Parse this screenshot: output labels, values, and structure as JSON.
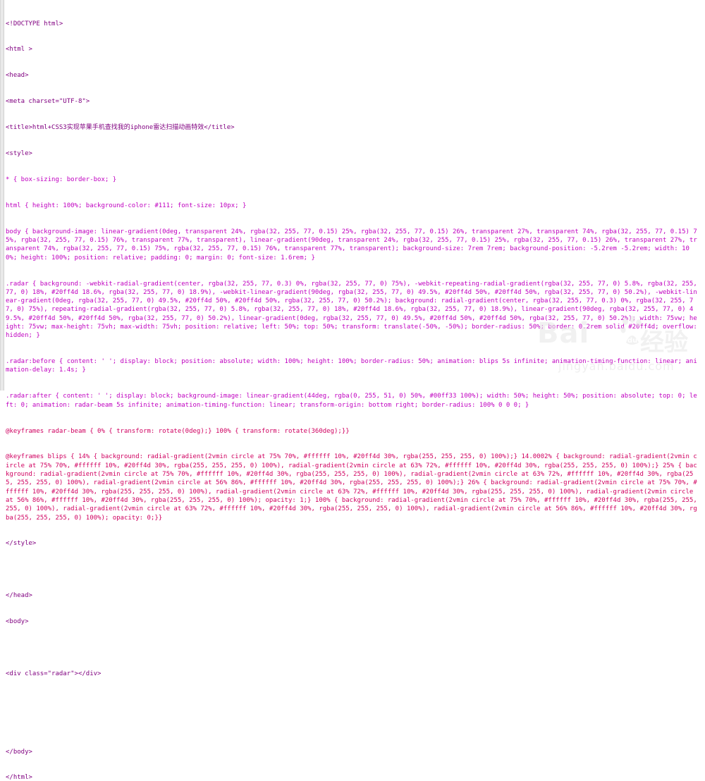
{
  "editor": {
    "lines": [
      "<!DOCTYPE html>",
      "<html >",
      "<head>",
      "<meta charset=\"UTF-8\">",
      "<title>html+CSS3实现苹果手机查找我的iphone雷达扫描动画特效</title>",
      "<style>",
      "* { box-sizing: border-box; }",
      "html { height: 100%; background-color: #111; font-size: 10px; }",
      "body { background-image: linear-gradient(0deg, transparent 24%, rgba(32, 255, 77, 0.15) 25%, rgba(32, 255, 77, 0.15) 26%, transparent 27%, transparent 74%, rgba(32, 255, 77, 0.15) 75%, rgba(32, 255, 77, 0.15) 76%, transparent 77%, transparent), linear-gradient(90deg, transparent 24%, rgba(32, 255, 77, 0.15) 25%, rgba(32, 255, 77, 0.15) 26%, transparent 27%, transparent 74%, rgba(32, 255, 77, 0.15) 75%, rgba(32, 255, 77, 0.15) 76%, transparent 77%, transparent); background-size: 7rem 7rem; background-position: -5.2rem -5.2rem; width: 100%; height: 100%; position: relative; padding: 0; margin: 0; font-size: 1.6rem; }",
      ".radar { background: -webkit-radial-gradient(center, rgba(32, 255, 77, 0.3) 0%, rgba(32, 255, 77, 0) 75%), -webkit-repeating-radial-gradient(rgba(32, 255, 77, 0) 5.8%, rgba(32, 255, 77, 0) 18%, #20ff4d 18.6%, rgba(32, 255, 77, 0) 18.9%), -webkit-linear-gradient(90deg, rgba(32, 255, 77, 0) 49.5%, #20ff4d 50%, #20ff4d 50%, rgba(32, 255, 77, 0) 50.2%), -webkit-linear-gradient(0deg, rgba(32, 255, 77, 0) 49.5%, #20ff4d 50%, #20ff4d 50%, rgba(32, 255, 77, 0) 50.2%); background: radial-gradient(center, rgba(32, 255, 77, 0.3) 0%, rgba(32, 255, 77, 0) 75%), repeating-radial-gradient(rgba(32, 255, 77, 0) 5.8%, rgba(32, 255, 77, 0) 18%, #20ff4d 18.6%, rgba(32, 255, 77, 0) 18.9%), linear-gradient(90deg, rgba(32, 255, 77, 0) 49.5%, #20ff4d 50%, #20ff4d 50%, rgba(32, 255, 77, 0) 50.2%), linear-gradient(0deg, rgba(32, 255, 77, 0) 49.5%, #20ff4d 50%, #20ff4d 50%, rgba(32, 255, 77, 0) 50.2%); width: 75vw; height: 75vw; max-height: 75vh; max-width: 75vh; position: relative; left: 50%; top: 50%; transform: translate(-50%, -50%); border-radius: 50%; border: 0.2rem solid #20ff4d; overflow: hidden; }",
      ".radar:before { content: ' '; display: block; position: absolute; width: 100%; height: 100%; border-radius: 50%; animation: blips 5s infinite; animation-timing-function: linear; animation-delay: 1.4s; }",
      ".radar:after { content: ' '; display: block; background-image: linear-gradient(44deg, rgba(0, 255, 51, 0) 50%, #00ff33 100%); width: 50%; height: 50%; position: absolute; top: 0; left: 0; animation: radar-beam 5s infinite; animation-timing-function: linear; transform-origin: bottom right; border-radius: 100% 0 0 0; }",
      "@keyframes radar-beam { 0% { transform: rotate(0deg);} 100% { transform: rotate(360deg);}}",
      "@keyframes blips { 14% { background: radial-gradient(2vmin circle at 75% 70%, #ffffff 10%, #20ff4d 30%, rgba(255, 255, 255, 0) 100%);} 14.0002% { background: radial-gradient(2vmin circle at 75% 70%, #ffffff 10%, #20ff4d 30%, rgba(255, 255, 255, 0) 100%), radial-gradient(2vmin circle at 63% 72%, #ffffff 10%, #20ff4d 30%, rgba(255, 255, 255, 0) 100%);} 25% { background: radial-gradient(2vmin circle at 75% 70%, #ffffff 10%, #20ff4d 30%, rgba(255, 255, 255, 0) 100%), radial-gradient(2vmin circle at 63% 72%, #ffffff 10%, #20ff4d 30%, rgba(255, 255, 255, 0) 100%), radial-gradient(2vmin circle at 56% 86%, #ffffff 10%, #20ff4d 30%, rgba(255, 255, 255, 0) 100%);} 26% { background: radial-gradient(2vmin circle at 75% 70%, #ffffff 10%, #20ff4d 30%, rgba(255, 255, 255, 0) 100%), radial-gradient(2vmin circle at 63% 72%, #ffffff 10%, #20ff4d 30%, rgba(255, 255, 255, 0) 100%), radial-gradient(2vmin circle at 56% 86%, #ffffff 10%, #20ff4d 30%, rgba(255, 255, 255, 0) 100%); opacity: 1;} 100% { background: radial-gradient(2vmin circle at 75% 70%, #ffffff 10%, #20ff4d 30%, rgba(255, 255, 255, 0) 100%), radial-gradient(2vmin circle at 63% 72%, #ffffff 10%, #20ff4d 30%, rgba(255, 255, 255, 0) 100%), radial-gradient(2vmin circle at 56% 86%, #ffffff 10%, #20ff4d 30%, rgba(255, 255, 255, 0) 100%); opacity: 0;}}",
      "</style>",
      "",
      "</head>",
      "<body>",
      "",
      "<div class=\"radar\"></div>",
      "",
      "",
      "</body>",
      "</html>"
    ]
  },
  "watermark": {
    "logo_text": "Bai",
    "cn_text": "经验",
    "url_text": "jingyan.baidu.com"
  }
}
